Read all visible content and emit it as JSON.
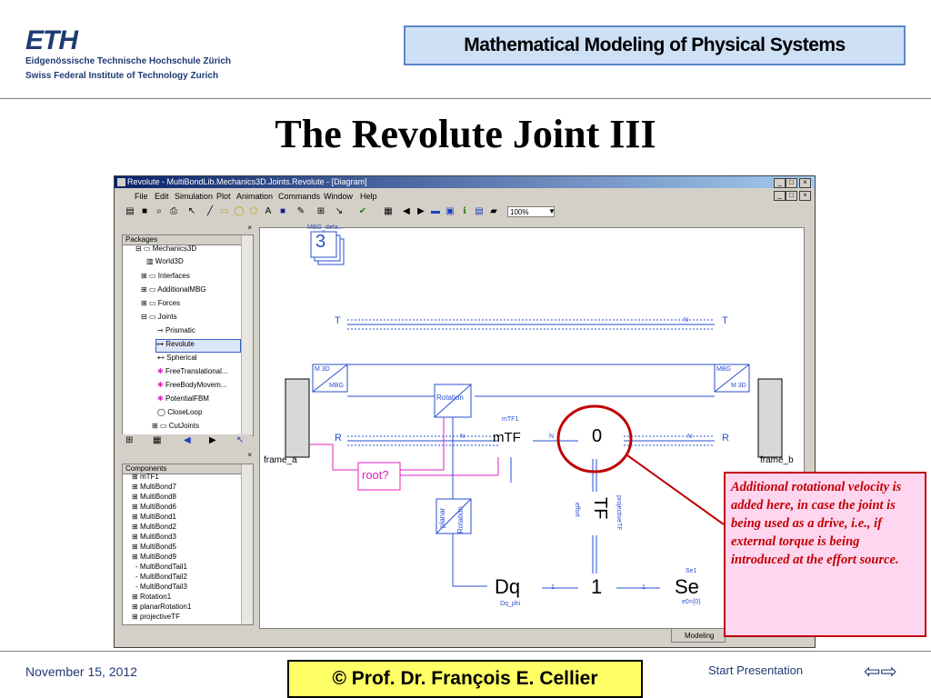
{
  "header": {
    "logo": "ETH",
    "institution_de": "Eidgenössische Technische Hochschule Zürich",
    "institution_en": "Swiss Federal Institute of Technology Zurich",
    "course_title": "Mathematical Modeling of Physical Systems"
  },
  "slide_title": "The Revolute Joint III",
  "app": {
    "window_title": "Revolute - MultiBondLib.Mechanics3D.Joints.Revolute - [Diagram]",
    "menu": [
      "File",
      "Edit",
      "Simulation",
      "Plot",
      "Animation",
      "Commands",
      "Window",
      "Help"
    ],
    "zoom": "100%",
    "packages_title": "Packages",
    "packages": [
      "Mechanics3D",
      "World3D",
      "Interfaces",
      "AdditionalMBG",
      "Forces",
      "Joints",
      "Prismatic",
      "Revolute",
      "Spherical",
      "FreeTranslational...",
      "FreeBodyMovem...",
      "PotentialFBM",
      "CloseLoop",
      "CutJoints"
    ],
    "components_title": "Components",
    "components": [
      "mTF1",
      "MultiBond7",
      "MultiBond8",
      "MultiBond6",
      "MultiBond1",
      "MultiBond2",
      "MultiBond3",
      "MultiBond5",
      "MultiBond9",
      "MultiBondTail1",
      "MultiBondTail2",
      "MultiBondTail3",
      "Rotation1",
      "planarRotation1",
      "projectiveTF"
    ],
    "status_tab": "Modeling"
  },
  "diagram": {
    "mbg_label": "MBG_defa...",
    "mbg_number": "3",
    "T": "T",
    "R": "R",
    "N": "N",
    "frame_a": "frame_a",
    "frame_b": "frame_b",
    "m3d": "M 3D",
    "mbg": "MBG",
    "rotation": "Rotation",
    "mtf_label": "mTF1",
    "mtf": "mTF",
    "zero": "0",
    "one": "1",
    "root": "root?",
    "planar": "planar",
    "tf": "TF",
    "effort": "effort",
    "projective": "projectiveTF",
    "dq": "Dq",
    "dq_phi": "Dq_phi",
    "se": "Se",
    "se1": "Se1",
    "se_eq": "e0={0}",
    "bond_one": "1"
  },
  "callout": "Additional rotational velocity is added here, in case the joint is being used as a drive, i.e., if external torque is being introduced at the effort source.",
  "footer": {
    "date": "November 15, 2012",
    "author": "©  Prof. Dr. François E. Cellier",
    "start": "Start Presentation"
  },
  "colors": {
    "bond_blue": "#2a4fd0",
    "root_magenta": "#e020c0",
    "highlight_red": "#c00000"
  }
}
